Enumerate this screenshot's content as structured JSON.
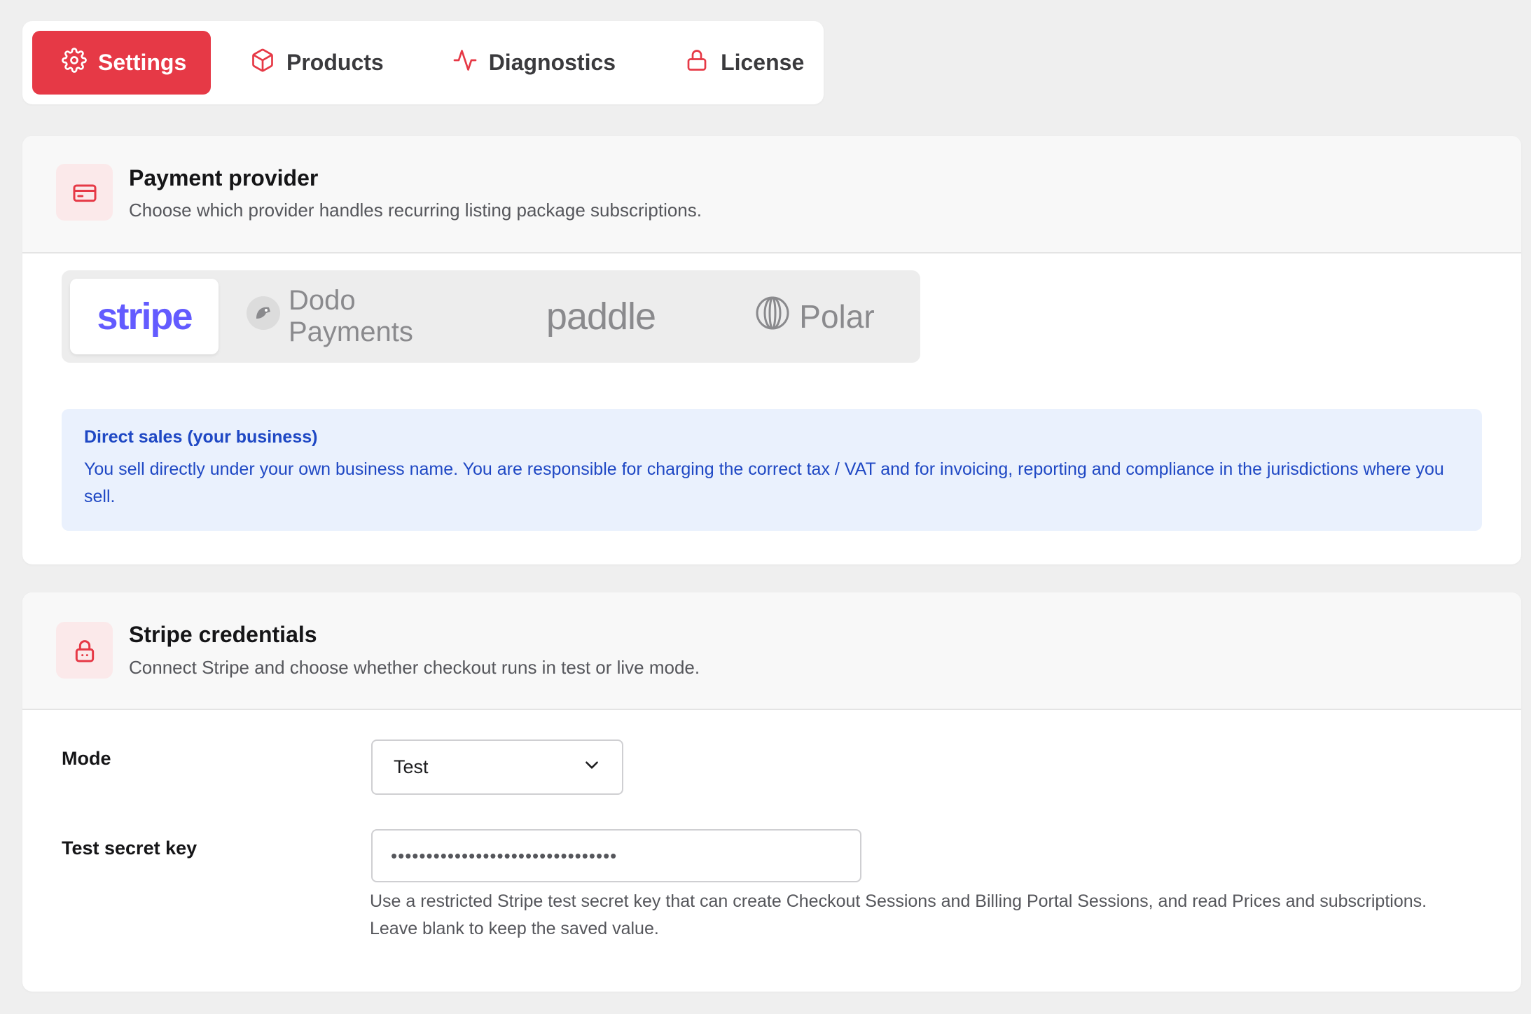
{
  "tabs": [
    {
      "label": "Settings",
      "icon": "gear-icon",
      "active": true
    },
    {
      "label": "Products",
      "icon": "box-icon",
      "active": false
    },
    {
      "label": "Diagnostics",
      "icon": "pulse-icon",
      "active": false
    },
    {
      "label": "License",
      "icon": "lock-icon",
      "active": false
    }
  ],
  "payment": {
    "title": "Payment provider",
    "subtitle": "Choose which provider handles recurring listing package subscriptions.",
    "providers": [
      {
        "label": "stripe",
        "active": true
      },
      {
        "label": "Dodo Payments",
        "active": false
      },
      {
        "label": "paddle",
        "active": false
      },
      {
        "label": "Polar",
        "active": false
      }
    ],
    "info_title": "Direct sales (your business)",
    "info_text": "You sell directly under your own business name. You are responsible for charging the correct tax / VAT and for invoicing, reporting and compliance in the jurisdictions where you sell."
  },
  "credentials": {
    "title": "Stripe credentials",
    "subtitle": "Connect Stripe and choose whether checkout runs in test or live mode.",
    "mode_label": "Mode",
    "mode_value": "Test",
    "key_label": "Test secret key",
    "key_value": "••••••••••••••••••••••••••••••••",
    "help_line1": "Use a restricted Stripe test secret key that can create Checkout Sessions and Billing Portal Sessions, and read Prices and subscriptions.",
    "help_line2": "Leave blank to keep the saved value."
  },
  "colors": {
    "accent": "#e63946",
    "stripe": "#635bff",
    "info_bg": "#eaf1fd",
    "info_text": "#1f48c4"
  }
}
